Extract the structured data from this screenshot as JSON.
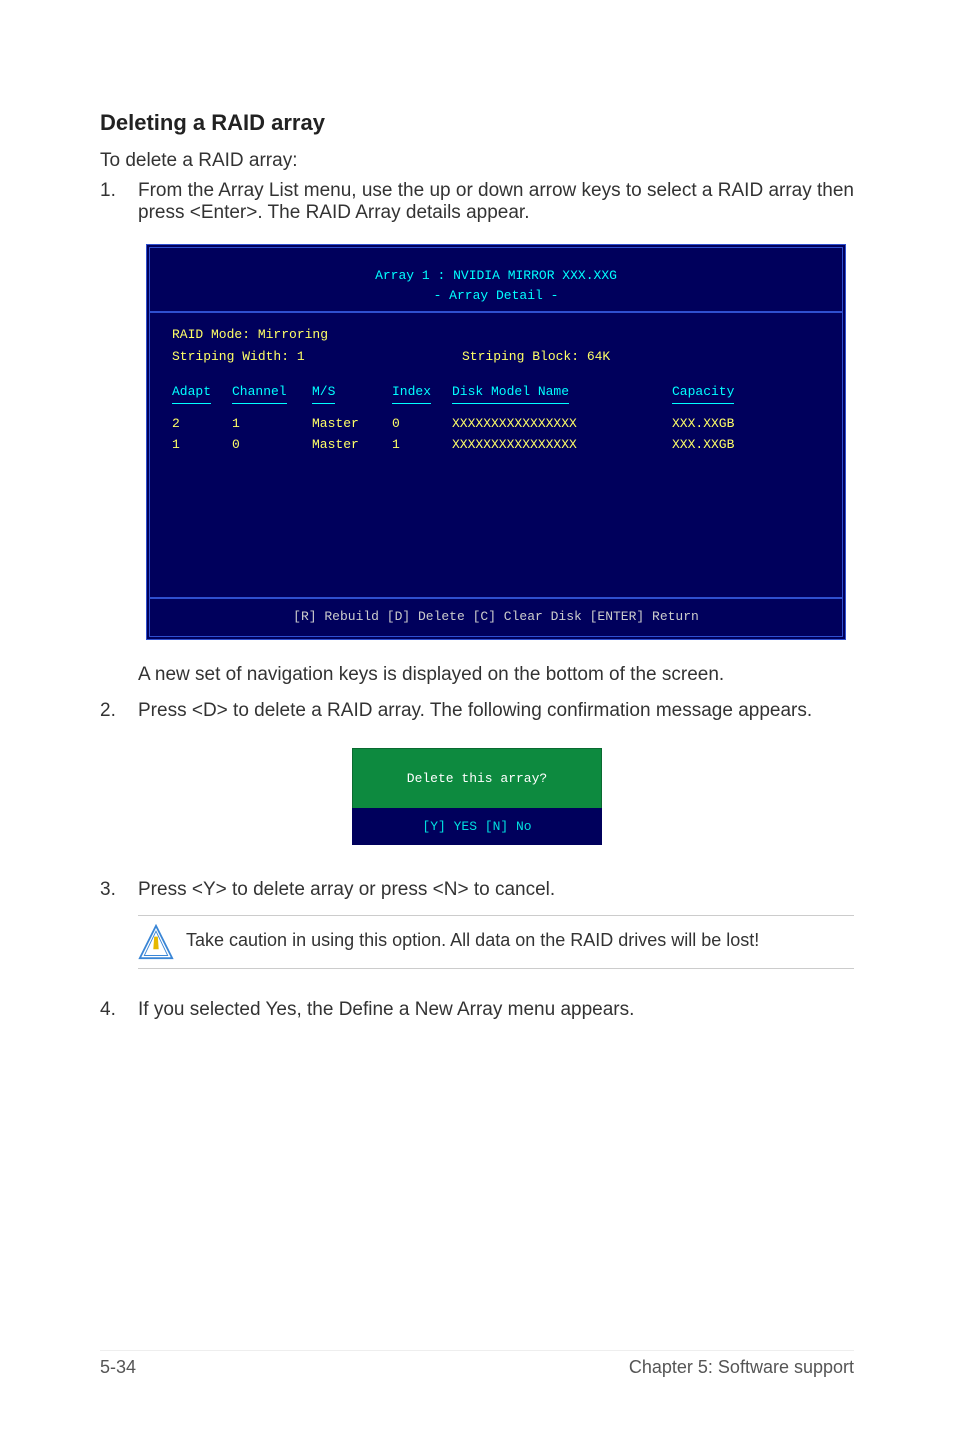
{
  "title": "Deleting a RAID array",
  "intro": "To delete a RAID array:",
  "steps": {
    "s1_num": "1.",
    "s1_txt": "From the Array List menu, use the up or down arrow keys to select a RAID array then press <Enter>. The RAID Array details appear.",
    "s2_intro": "A new set of  navigation keys is displayed on the bottom of the screen.",
    "s2_num": "2.",
    "s2_txt": "Press <D> to delete a RAID array. The following confirmation message appears.",
    "s3_num": "3.",
    "s3_txt": "Press <Y> to delete array or press <N> to cancel.",
    "s4_num": "4.",
    "s4_txt": "If you selected Yes, the Define a New Array menu appears."
  },
  "terminal": {
    "header_line1": "Array 1 : NVIDIA MIRROR  XXX.XXG",
    "header_line2": "- Array Detail -",
    "raid_mode": "RAID Mode: Mirroring",
    "striping_width": "Striping Width: 1",
    "striping_block": "Striping Block: 64K",
    "hdr_adapt": "Adapt",
    "hdr_channel": "Channel",
    "hdr_ms": "M/S",
    "hdr_index": "Index",
    "hdr_model": "Disk Model Name",
    "hdr_capacity": "Capacity",
    "rows": [
      {
        "adapt": "2",
        "channel": "1",
        "ms": "Master",
        "index": "0",
        "model": "XXXXXXXXXXXXXXXX",
        "cap": "XXX.XXGB"
      },
      {
        "adapt": "1",
        "channel": "0",
        "ms": "Master",
        "index": "1",
        "model": "XXXXXXXXXXXXXXXX",
        "cap": "XXX.XXGB"
      }
    ],
    "footer": "[R] Rebuild  [D] Delete  [C] Clear Disk  [ENTER] Return"
  },
  "dialog": {
    "question": "Delete this array?",
    "options": "[Y] YES   [N] No"
  },
  "notice": "Take caution in using this option. All data on the RAID drives will be lost!",
  "page_footer": {
    "left": "5-34",
    "right": "Chapter 5: Software support"
  }
}
